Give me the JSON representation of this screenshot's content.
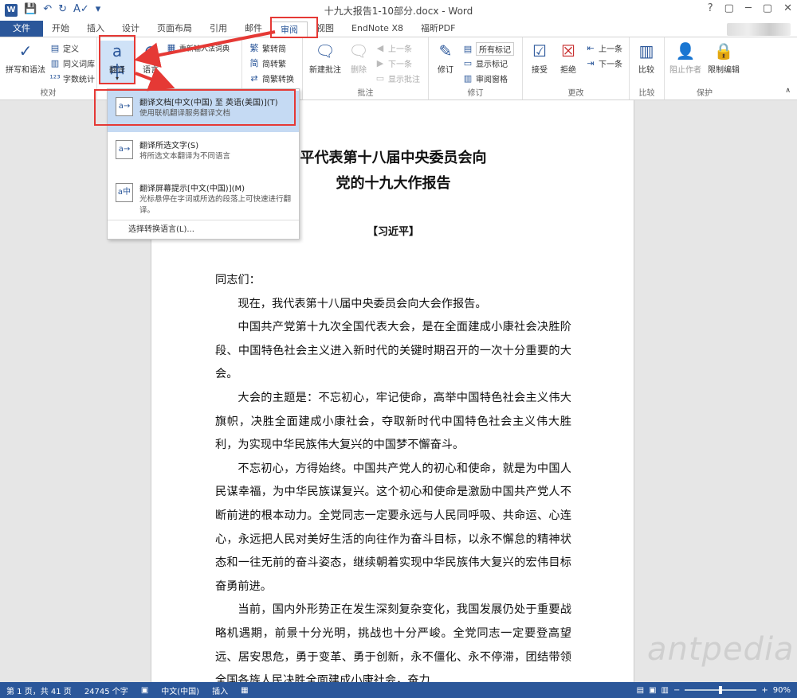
{
  "window": {
    "title": "十九大报告1-10部分.docx - Word",
    "app_logo": "W",
    "controls": [
      "?",
      "▢",
      "─",
      "▢",
      "✕"
    ]
  },
  "tabs": [
    "文件",
    "开始",
    "插入",
    "设计",
    "页面布局",
    "引用",
    "邮件",
    "审阅",
    "视图",
    "EndNote X8",
    "福昕PDF"
  ],
  "active_tab": "审阅",
  "ribbon": {
    "proofing": {
      "spell": "拼写和语法",
      "define": "定义",
      "thesaurus": "同义词库",
      "wordcount": "字数统计",
      "label": "校对"
    },
    "language": {
      "translate": "翻译",
      "language": "语言",
      "reconvert": "重新输入法词典"
    },
    "chinese": {
      "to_trad": "繁转简",
      "to_simp": "简转繁",
      "convert": "简繁转换"
    },
    "comments": {
      "new": "新建批注",
      "delete": "删除",
      "prev": "上一条",
      "next": "下一条",
      "show": "显示批注",
      "label": "批注"
    },
    "tracking": {
      "track": "修订",
      "markup": "所有标记",
      "show_markup": "显示标记",
      "pane": "审阅窗格",
      "label": "修订"
    },
    "changes": {
      "accept": "接受",
      "reject": "拒绝",
      "prev": "上一条",
      "next": "下一条",
      "label": "更改"
    },
    "compare": {
      "compare": "比较",
      "label": "比较"
    },
    "protect": {
      "block": "阻止作者",
      "restrict": "限制编辑",
      "label": "保护"
    }
  },
  "dropdown": {
    "items": [
      {
        "title": "翻译文档[中文(中国) 至 英语(美国)](T)",
        "desc": "使用联机翻译服务翻译文档"
      },
      {
        "title": "翻译所选文字(S)",
        "desc": "将所选文本翻译为不同语言"
      },
      {
        "title": "翻译屏幕提示[中文(中国)](M)",
        "desc": "光标悬停在字词或所选的段落上可快速进行翻译。"
      }
    ],
    "footer": "选择转换语言(L)..."
  },
  "document": {
    "title_line1": "平代表第十八届中央委员会向",
    "title_line2": "党的十九大作报告",
    "author": "【习近平】",
    "paragraphs": [
      "同志们：",
      "现在，我代表第十八届中央委员会向大会作报告。",
      "中国共产党第十九次全国代表大会，是在全面建成小康社会决胜阶段、中国特色社会主义进入新时代的关键时期召开的一次十分重要的大会。",
      "大会的主题是：不忘初心，牢记使命，高举中国特色社会主义伟大旗帜，决胜全面建成小康社会，夺取新时代中国特色社会主义伟大胜利，为实现中华民族伟大复兴的中国梦不懈奋斗。",
      "不忘初心，方得始终。中国共产党人的初心和使命，就是为中国人民谋幸福，为中华民族谋复兴。这个初心和使命是激励中国共产党人不断前进的根本动力。全党同志一定要永远与人民同呼吸、共命运、心连心，永远把人民对美好生活的向往作为奋斗目标，以永不懈怠的精神状态和一往无前的奋斗姿态，继续朝着实现中华民族伟大复兴的宏伟目标奋勇前进。",
      "当前，国内外形势正在发生深刻复杂变化，我国发展仍处于重要战略机遇期，前景十分光明，挑战也十分严峻。全党同志一定要登高望远、居安思危，勇于变革、勇于创新，永不僵化、永不停滞，团结带领全国各族人民决胜全面建成小康社会，奋力"
    ],
    "watermark": "antpedia"
  },
  "status": {
    "page": "第 1 页，共 41 页",
    "words": "24745 个字",
    "lang": "中文(中国)",
    "mode": "插入",
    "zoom": "90%",
    "zoom_fraction": 0.5
  },
  "colors": {
    "accent": "#2b579a",
    "highlight": "#c5daf3",
    "annotation": "#e53935"
  }
}
